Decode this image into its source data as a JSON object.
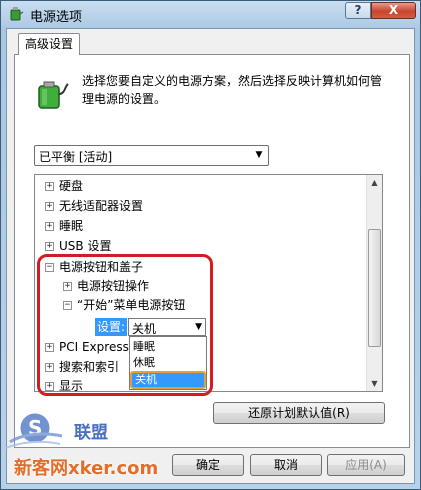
{
  "window": {
    "title": "电源选项",
    "help_label": "?",
    "close_label": "X"
  },
  "tab": {
    "label": "高级设置"
  },
  "description": "选择您要自定义的电源方案，然后选择反映计算机如何管理电源的设置。",
  "plan_select": {
    "value": "已平衡 [活动]"
  },
  "tree": {
    "items": [
      {
        "label": "硬盘",
        "expander": "+"
      },
      {
        "label": "无线适配器设置",
        "expander": "+"
      },
      {
        "label": "睡眠",
        "expander": "+"
      },
      {
        "label": "USB 设置",
        "expander": "+"
      },
      {
        "label": "电源按钮和盖子",
        "expander": "−"
      },
      {
        "label": "电源按钮操作",
        "expander": "+"
      },
      {
        "label": "“开始”菜单电源按钮",
        "expander": "−"
      },
      {
        "label": "PCI Express",
        "expander": "+"
      },
      {
        "label": "搜索和索引",
        "expander": "+"
      },
      {
        "label": "显示",
        "expander": "+"
      }
    ],
    "setting": {
      "label": "设置:",
      "value": "关机",
      "options": [
        "睡眠",
        "休眠",
        "关机"
      ]
    }
  },
  "buttons": {
    "restore": "还原计划默认值(R)",
    "ok": "确定",
    "cancel": "取消",
    "apply": "应用(A)"
  },
  "watermark": {
    "site": "新客网",
    "domain": "xker.com",
    "brand": "联盟"
  },
  "colors": {
    "selection": "#3399ff",
    "annotation": "#d21c22",
    "watermark_orange": "#e46d2a"
  }
}
